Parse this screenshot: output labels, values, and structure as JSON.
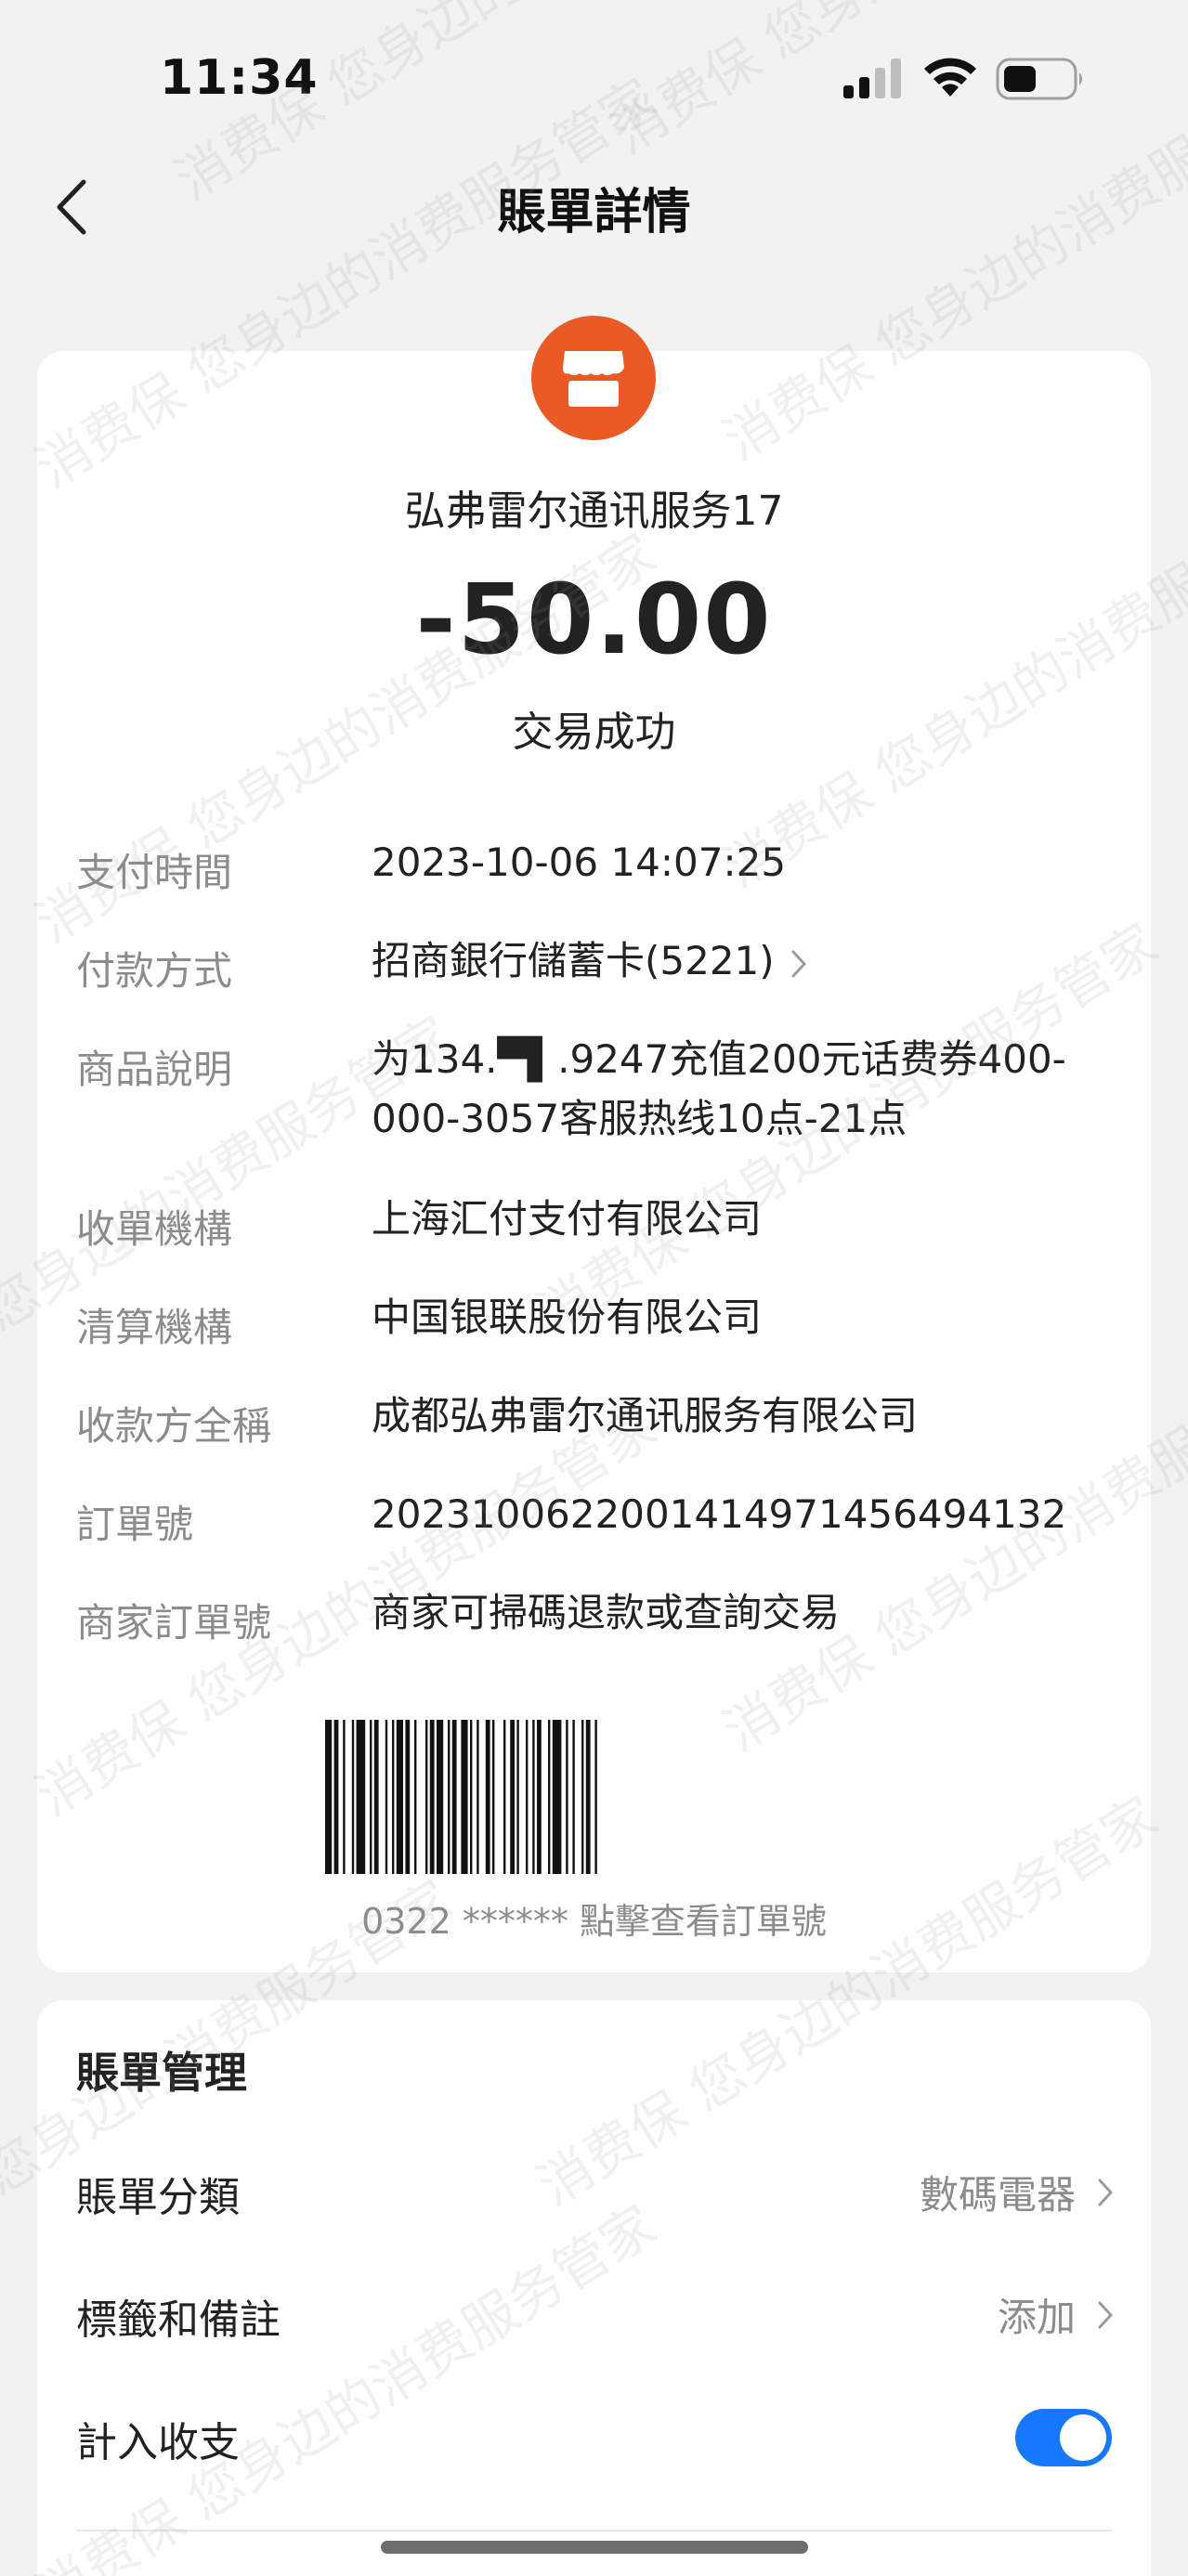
{
  "status_bar": {
    "time": "11:34"
  },
  "nav": {
    "title": "賬單詳情"
  },
  "transaction": {
    "merchant_name": "弘弗雷尔通讯服务17",
    "amount": "-50.00",
    "status": "交易成功",
    "logo_color": "#e95a24",
    "logo_icon": "store-icon"
  },
  "details": [
    {
      "label": "支付時間",
      "value": "2023-10-06 14:07:25"
    },
    {
      "label": "付款方式",
      "value": "招商銀行儲蓄卡(5221)"
    },
    {
      "label": "商品說明",
      "value_line1": "为134.▀▌.9247充值200元话费券400-",
      "value_line2": "000-3057客服热线10点-21点"
    },
    {
      "label": "收單機構",
      "value": "上海汇付支付有限公司"
    },
    {
      "label": "清算機構",
      "value": "中国银联股份有限公司"
    },
    {
      "label": "收款方全稱",
      "value": "成都弘弗雷尔通讯服务有限公司"
    },
    {
      "label": "訂單號",
      "value": "2023100622001414971456494132"
    },
    {
      "label": "商家訂單號",
      "value": "商家可掃碼退款或查詢交易"
    }
  ],
  "barcode": {
    "caption": "0322 ****** 點擊查看訂單號"
  },
  "manage": {
    "title": "賬單管理",
    "rows": [
      {
        "label": "賬單分類",
        "value": "數碼電器"
      },
      {
        "label": "標籤和備註",
        "value": "添加"
      },
      {
        "label": "計入收支",
        "toggle_on": true
      }
    ],
    "toggle_color": "#1677ff"
  },
  "watermark": {
    "text": "消费保 您身边的消费服务管家"
  }
}
